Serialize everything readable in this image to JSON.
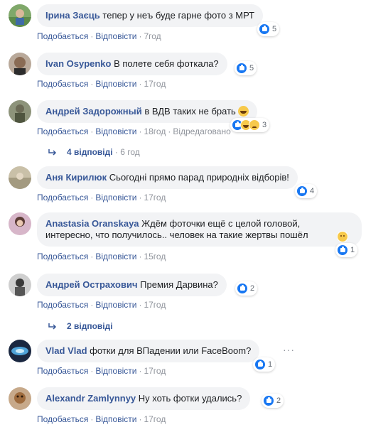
{
  "colors": {
    "author": "#385898",
    "like": "#1877f2",
    "bubble": "#f2f3f5",
    "meta": "#90949c"
  },
  "meta_labels": {
    "like": "Подобається",
    "reply": "Відповісти",
    "edited": "Відредаговано"
  },
  "comments": [
    {
      "author": "Ірина Заєць",
      "text": "тепер у неъ буде гарне фото з МРТ",
      "reactions": [
        "like"
      ],
      "count": "5",
      "time": "7год"
    },
    {
      "author": "Ivan Osypenko",
      "text": "В полете себя фоткала?",
      "reactions": [
        "like"
      ],
      "count": "5",
      "time": "17год"
    },
    {
      "author": "Андрей Задорожный",
      "text": "в ВДВ таких не брать",
      "emoji": "laughing-emoji",
      "reactions": [
        "like",
        "haha",
        "sad"
      ],
      "count": "3",
      "time": "18год",
      "edited": true
    },
    {
      "author": "Аня Кирилюк",
      "text": "Сьогодні прямо парад природніх відборів!",
      "reactions": [
        "like"
      ],
      "count": "4",
      "time": "17год"
    },
    {
      "author": "Anastasia Oranskaya",
      "text_lines": [
        "Ждём фоточки ещё с целой головой,",
        "интересно, что получилось.. человек на такие жертвы пошёл"
      ],
      "reactions": [
        "like"
      ],
      "count": "1",
      "time": "15год"
    },
    {
      "author": "Андрей Острахович",
      "text": "Премия Дарвина?",
      "reactions": [
        "like"
      ],
      "count": "2",
      "time": "17год"
    },
    {
      "author": "Vlad Vlad",
      "text": "фотки для ВПадении или FaceBoom?",
      "reactions": [
        "like"
      ],
      "count": "1",
      "time": "17год"
    },
    {
      "author": "Alexandr Zamlynnyy",
      "text": "Ну хоть фотки удались?",
      "reactions": [
        "like"
      ],
      "count": "2",
      "time": "17год"
    }
  ],
  "reply_threads": [
    {
      "label": "4 відповіді",
      "time": "6 год"
    },
    {
      "label": "2 відповіді"
    }
  ]
}
